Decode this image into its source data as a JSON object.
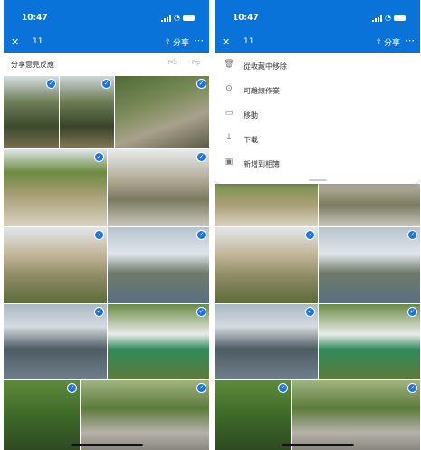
{
  "status_bar": {
    "time": "10:47"
  },
  "appbar": {
    "close_icon": "close-icon",
    "selected_count": "11",
    "share_label": "分享",
    "more_icon": "more-icon"
  },
  "feedback": {
    "label": "分享意見反應"
  },
  "menu": {
    "items": [
      {
        "label": "從收藏中移除",
        "icon": "trash-icon"
      },
      {
        "label": "可離線作業",
        "icon": "offline-icon"
      },
      {
        "label": "移動",
        "icon": "move-icon"
      },
      {
        "label": "下載",
        "icon": "download-icon"
      },
      {
        "label": "新增到相簿",
        "icon": "album-icon"
      }
    ]
  },
  "colors": {
    "accent": "#0a73d9",
    "checkmark": "#1a73e8"
  }
}
